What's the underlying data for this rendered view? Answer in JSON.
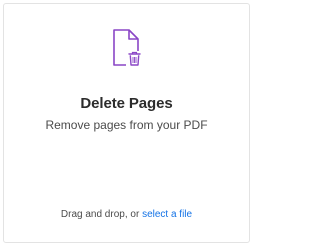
{
  "tool_card": {
    "title": "Delete Pages",
    "subtitle": "Remove pages from your PDF",
    "icon": "delete-pages-icon",
    "drop_prefix": "Drag and drop, or ",
    "drop_link": "select a file",
    "colors": {
      "icon_accent": "#8a46c6",
      "link": "#1473e6",
      "title": "#2c2c2c",
      "border": "#e3e3e3"
    }
  }
}
